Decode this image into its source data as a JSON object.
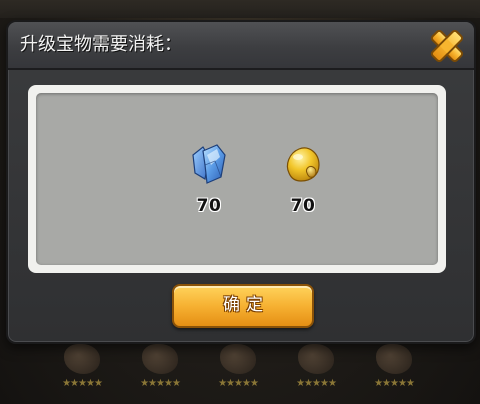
{
  "dialog": {
    "title": "升级宝物需要消耗：",
    "close_icon": "close-x-icon"
  },
  "costs": [
    {
      "name": "crystal",
      "icon": "blue-crystal-icon",
      "amount": "70",
      "color": "#4b86d6"
    },
    {
      "name": "gold",
      "icon": "gold-nugget-icon",
      "amount": "70",
      "color": "#e8b21c"
    }
  ],
  "confirm": {
    "label": "确定"
  },
  "colors": {
    "accent_orange": "#f6b132",
    "panel_dark": "#3b3c3e",
    "content_gray": "#a8a9a6"
  }
}
